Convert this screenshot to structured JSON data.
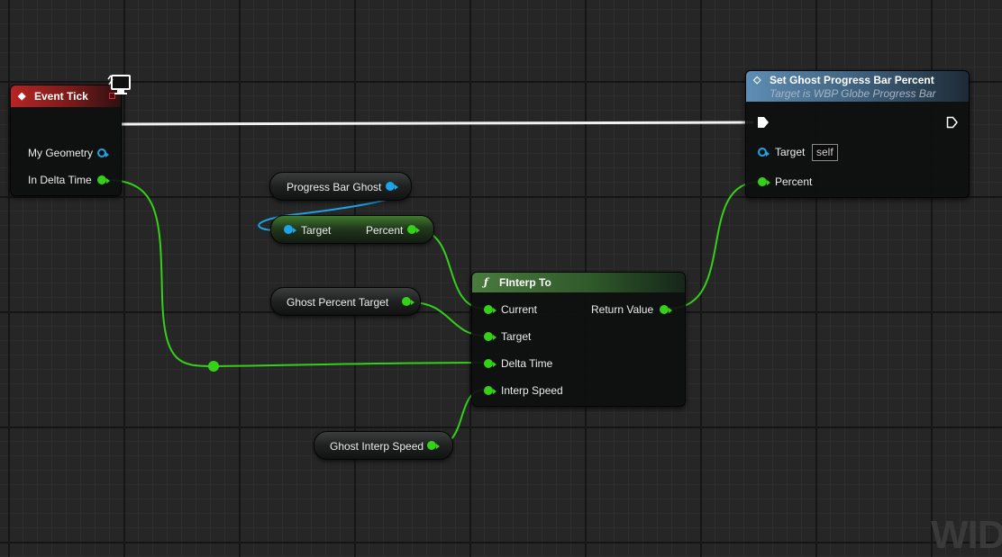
{
  "event_tick": {
    "title": "Event Tick",
    "pins": {
      "my_geometry": "My Geometry",
      "in_delta_time": "In Delta Time"
    }
  },
  "set_percent": {
    "title": "Set Ghost Progress Bar Percent",
    "subtitle": "Target is WBP Globe Progress Bar",
    "pins": {
      "target": "Target",
      "target_default": "self",
      "percent": "Percent"
    }
  },
  "progress_bar_ghost": {
    "label": "Progress Bar Ghost"
  },
  "get_percent": {
    "target": "Target",
    "percent": "Percent"
  },
  "ghost_percent_target": {
    "label": "Ghost Percent Target"
  },
  "finterp": {
    "title": "FInterp To",
    "pins": {
      "current": "Current",
      "target": "Target",
      "delta_time": "Delta Time",
      "interp_speed": "Interp Speed",
      "return_value": "Return Value"
    }
  },
  "ghost_interp_speed": {
    "label": "Ghost Interp Speed"
  },
  "watermark": "WID",
  "colors": {
    "float_pin": "#34d118",
    "object_pin": "#1aa6e8",
    "exec": "#ffffff"
  }
}
